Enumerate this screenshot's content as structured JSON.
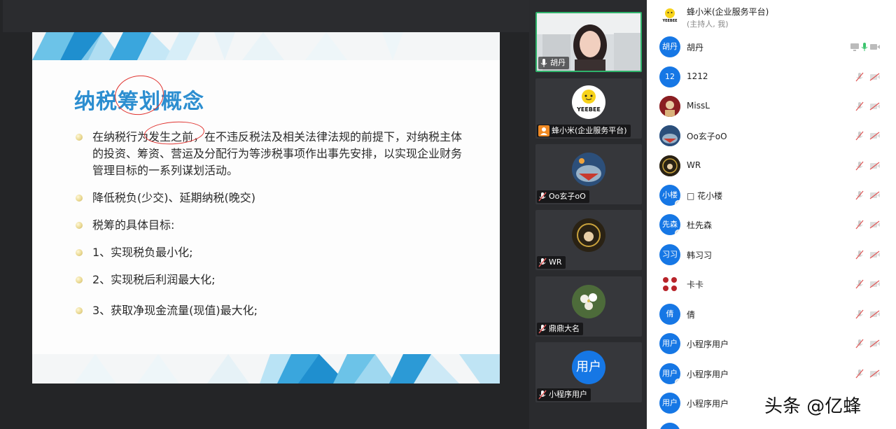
{
  "slide": {
    "title_prefix": "纳税",
    "title_circled": "筹划",
    "title_suffix": "概念",
    "bullets": [
      {
        "pre": "在纳税行为",
        "circled": "发生之前",
        "post": "，在不违反税法及相关法律法规的前提下，对纳税主体的投资、筹资、营运及分配行为等涉税事项作出事先安排，以实现企业财务管理目标的一系列谋划活动。"
      },
      {
        "text": "降低税负(少交)、延期纳税(晚交)"
      },
      {
        "text": "税筹的具体目标:"
      },
      {
        "text": "1、实现税负最小化;"
      },
      {
        "text": "2、实现税后利润最大化;"
      },
      {
        "text": "3、获取净现金流量(现值)最大化;"
      }
    ]
  },
  "video_tiles": [
    {
      "name": "胡丹"
    },
    {
      "name": "蜂小米(企业服务平台)",
      "logo_text": "YEEBEE"
    },
    {
      "name": "Oo玄子oO"
    },
    {
      "name": "WR"
    },
    {
      "name": "鼎鼎大名"
    },
    {
      "name": "小程序用户",
      "avatar_text": "用户"
    }
  ],
  "host": {
    "name": "蜂小米(企业服务平台)",
    "role": "(主持人, 我)",
    "logo_text": "YEEBEE"
  },
  "participants": [
    {
      "name": "胡丹",
      "avatar_text": "胡丹"
    },
    {
      "name": "1212",
      "avatar_text": "12"
    },
    {
      "name": "MissL",
      "avatar_text": ""
    },
    {
      "name": "Oo玄子oO",
      "avatar_text": ""
    },
    {
      "name": "WR",
      "avatar_text": ""
    },
    {
      "name": "□ 花小楼",
      "avatar_text": "小楼"
    },
    {
      "name": "杜先森",
      "avatar_text": "先森"
    },
    {
      "name": "韩习习",
      "avatar_text": "习习"
    },
    {
      "name": "卡卡",
      "avatar_text": ""
    },
    {
      "name": "倩",
      "avatar_text": "倩"
    },
    {
      "name": "小程序用户",
      "avatar_text": "用户"
    },
    {
      "name": "小程序用户",
      "avatar_text": "用户"
    },
    {
      "name": "小程序用户",
      "avatar_text": "用户"
    }
  ],
  "watermark": "头条 @亿蜂",
  "colors": {
    "title_blue": "#2c8ed0",
    "annotation_red": "#e0332f",
    "active_speaker_green": "#2fb36b",
    "avatar_blue": "#1677e5",
    "muted_red": "#e05a5a"
  }
}
